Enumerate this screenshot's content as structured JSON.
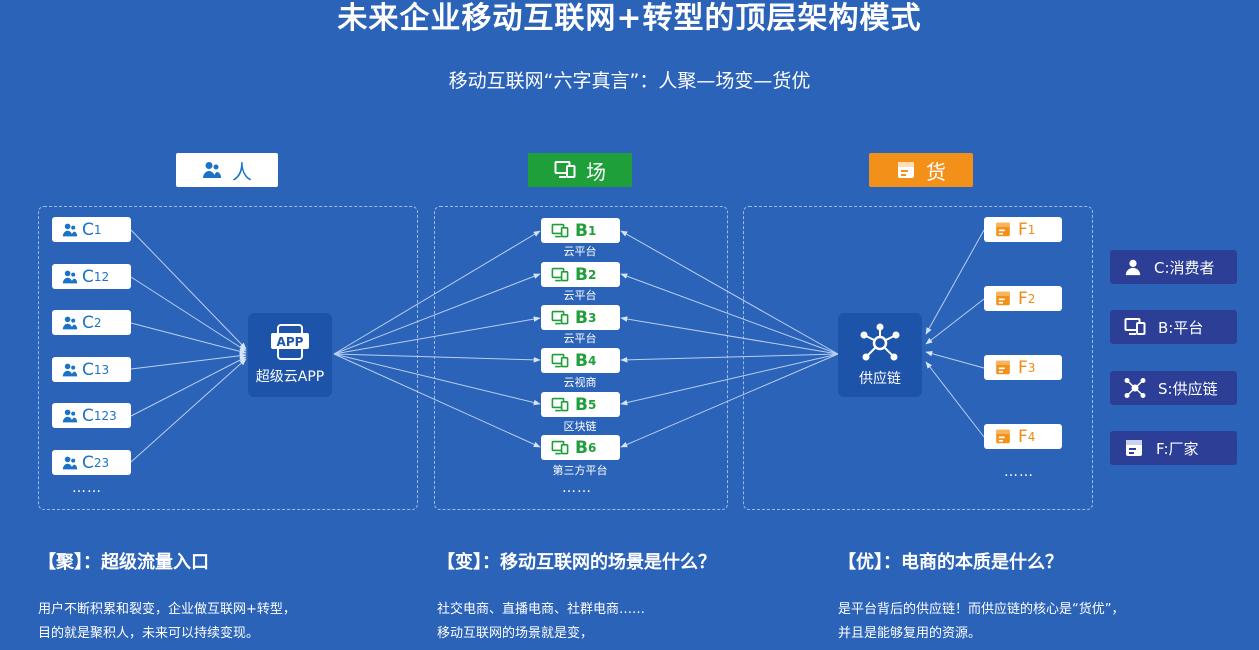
{
  "title": "未来企业移动互联网+转型的顶层架构模式",
  "subtitle": "移动互联网“六字真言”：人聚—场变—货优",
  "sections": {
    "people": "人",
    "scene": "场",
    "goods": "货"
  },
  "people_nodes": [
    {
      "letter": "C",
      "sub": "1"
    },
    {
      "letter": "C",
      "sub": "12"
    },
    {
      "letter": "C",
      "sub": "2"
    },
    {
      "letter": "C",
      "sub": "13"
    },
    {
      "letter": "C",
      "sub": "123"
    },
    {
      "letter": "C",
      "sub": "23"
    }
  ],
  "scene_nodes": [
    {
      "letter": "B",
      "sub": "1",
      "caption": "云平台"
    },
    {
      "letter": "B",
      "sub": "2",
      "caption": "云平台"
    },
    {
      "letter": "B",
      "sub": "3",
      "caption": "云平台"
    },
    {
      "letter": "B",
      "sub": "4",
      "caption": "云视商"
    },
    {
      "letter": "B",
      "sub": "5",
      "caption": "区块链"
    },
    {
      "letter": "B",
      "sub": "6",
      "caption": "第三方平台"
    }
  ],
  "goods_nodes": [
    {
      "letter": "F",
      "sub": "1"
    },
    {
      "letter": "F",
      "sub": "2"
    },
    {
      "letter": "F",
      "sub": "3"
    },
    {
      "letter": "F",
      "sub": "4"
    }
  ],
  "ellipsis": "……",
  "app_hub": {
    "badge": "APP",
    "label": "超级云APP"
  },
  "supply_hub": {
    "label": "供应链"
  },
  "legend": [
    {
      "icon": "person-icon",
      "label": "C:消费者"
    },
    {
      "icon": "monitor-icon",
      "label": "B:平台"
    },
    {
      "icon": "network-icon",
      "label": "S:供应链"
    },
    {
      "icon": "store-icon",
      "label": "F:厂家"
    }
  ],
  "bottom": [
    {
      "heading": "【聚】：超级流量入口",
      "lines": [
        "用户不断积累和裂变，企业做互联网+转型，",
        "目的就是聚积人，未来可以持续变现。"
      ]
    },
    {
      "heading": "【变】：移动互联网的场景是什么？",
      "lines": [
        "社交电商、直播电商、社群电商……",
        "移动互联网的场景就是变，"
      ]
    },
    {
      "heading": "【优】：电商的本质是什么？",
      "lines": [
        "是平台背后的供应链！而供应链的核心是“货优”，",
        "并且是能够复用的资源。"
      ]
    }
  ],
  "colors": {
    "background": "#2b63b8",
    "people": "#1a73c9",
    "scene": "#1f9f3a",
    "goods": "#f39019",
    "legend_bg": "#2c3e96"
  }
}
